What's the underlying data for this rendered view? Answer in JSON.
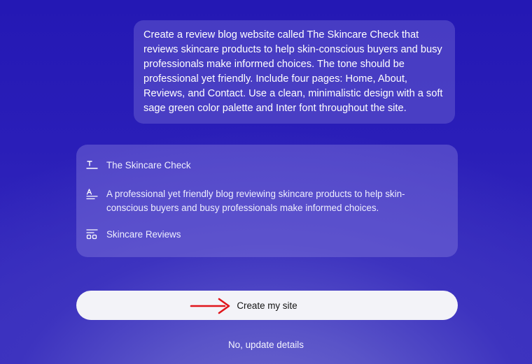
{
  "prompt": {
    "text": "Create a review blog website called The Skincare Check that reviews skincare products to help skin-conscious buyers and busy professionals make informed choices. The tone should be professional yet friendly. Include four pages: Home, About, Reviews, and Contact. Use a clean, minimalistic design with a soft sage green color palette and Inter font throughout the site."
  },
  "details": {
    "site_title": {
      "icon": "text-title-icon",
      "value": "The Skincare Check"
    },
    "description": {
      "icon": "text-description-icon",
      "value": "A professional yet friendly blog reviewing skincare products to help skin-conscious buyers and busy professionals make informed choices."
    },
    "category": {
      "icon": "layout-category-icon",
      "value": "Skincare Reviews"
    }
  },
  "actions": {
    "primary_label": "Create my site",
    "secondary_label": "No, update details"
  },
  "annotation": {
    "icon": "red-arrow-icon",
    "color": "#e0151b"
  }
}
